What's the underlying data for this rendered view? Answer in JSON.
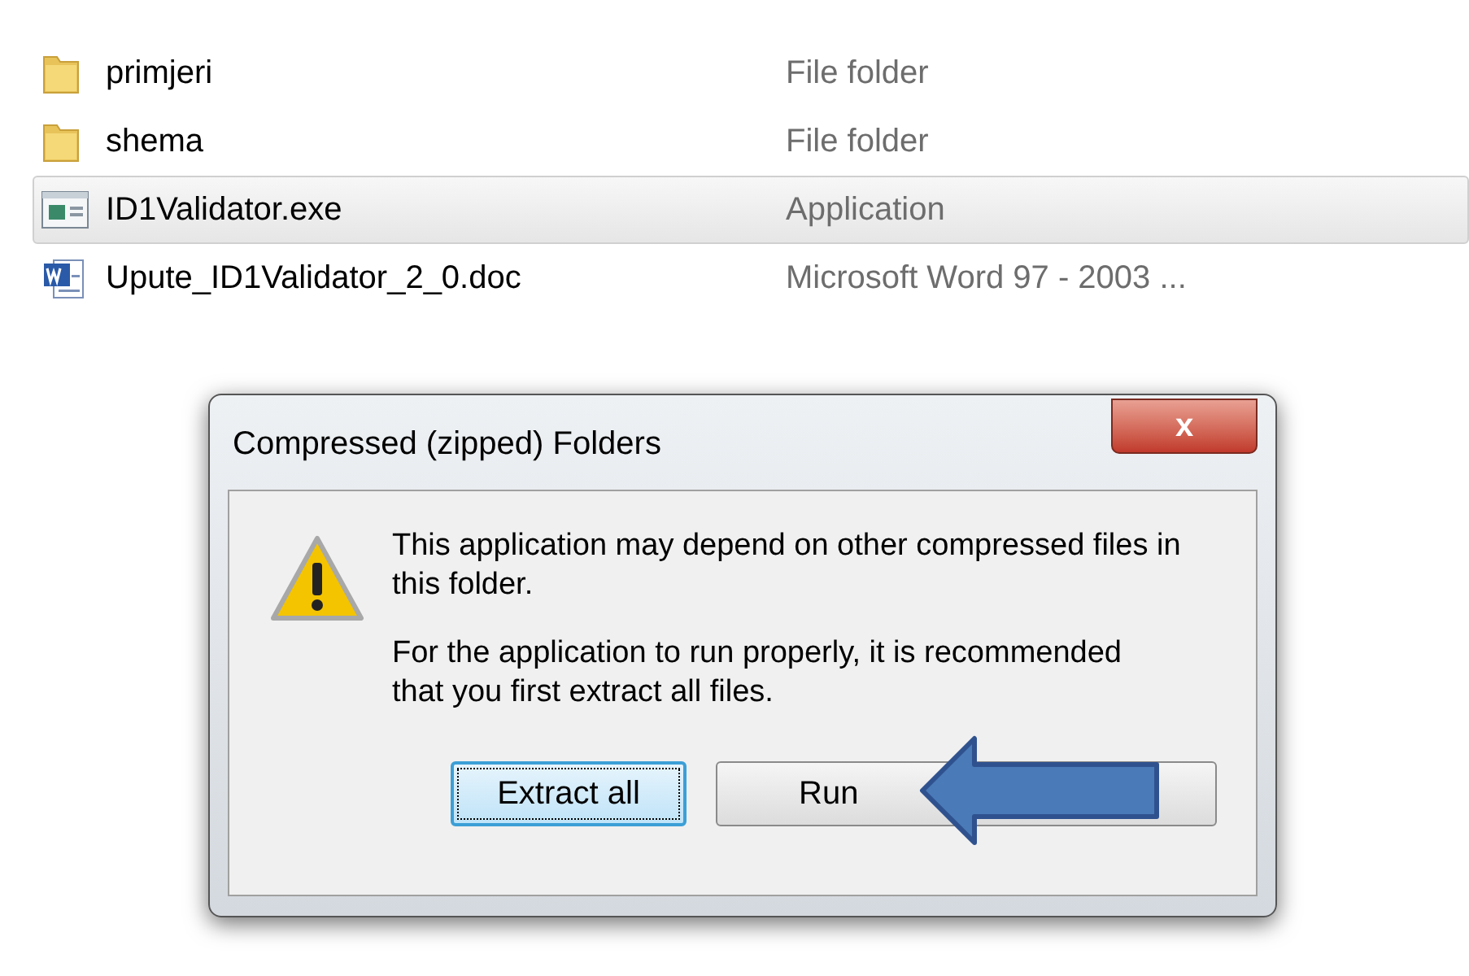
{
  "files": [
    {
      "kind": "folder",
      "name": "primjeri",
      "type": "File folder",
      "selected": false
    },
    {
      "kind": "folder",
      "name": "shema",
      "type": "File folder",
      "selected": false
    },
    {
      "kind": "application",
      "name": "ID1Validator.exe",
      "type": "Application",
      "selected": true
    },
    {
      "kind": "word",
      "name": "Upute_ID1Validator_2_0.doc",
      "type": "Microsoft Word 97 - 2003 ...",
      "selected": false
    }
  ],
  "dialog": {
    "title": "Compressed (zipped) Folders",
    "close": "x",
    "messages": [
      "This application may depend on other compressed files in this folder.",
      "For the application to run properly, it is recommended that you first extract all files."
    ],
    "buttons": [
      {
        "label": "Extract all",
        "default": true
      },
      {
        "label": "Run",
        "default": false
      }
    ]
  }
}
